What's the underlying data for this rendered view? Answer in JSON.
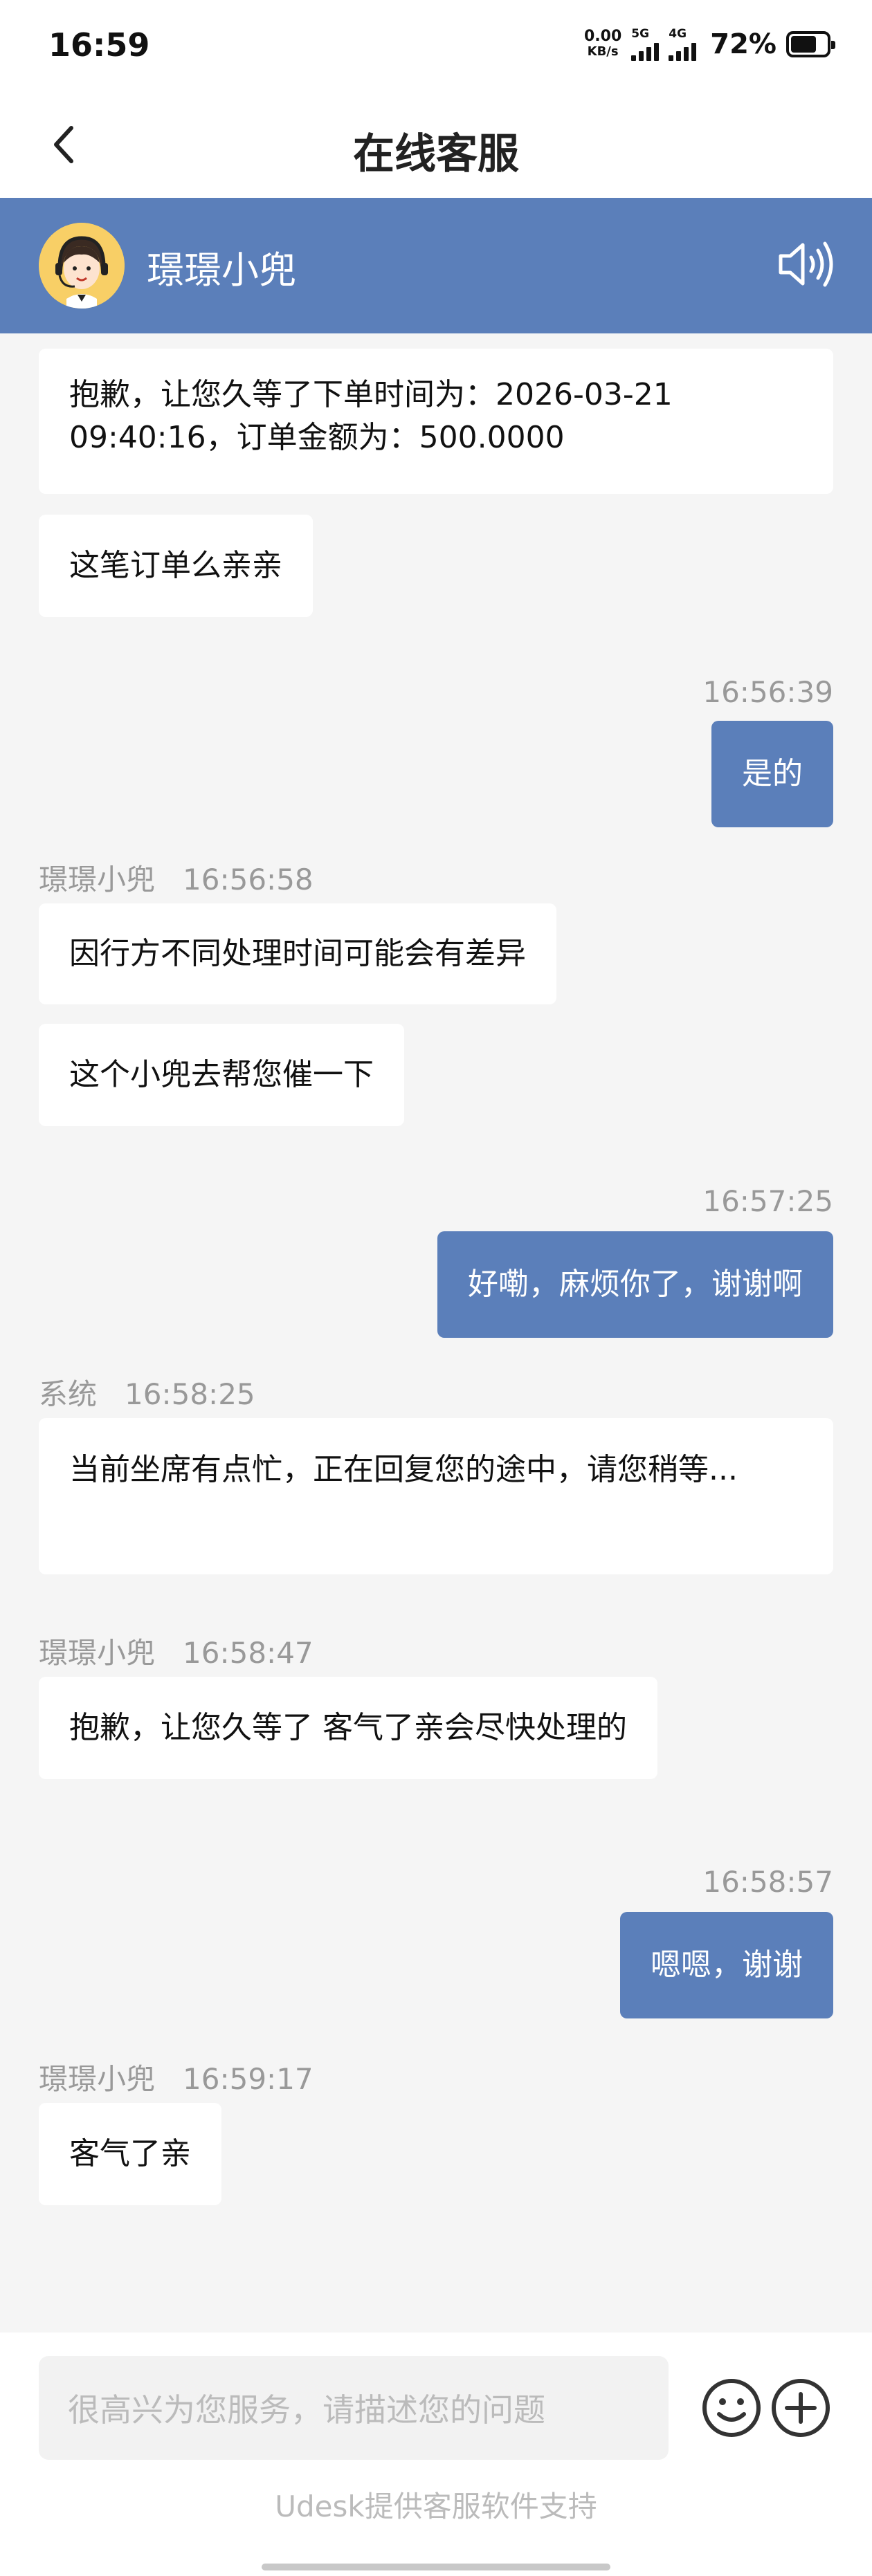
{
  "status_bar": {
    "time": "16:59",
    "net_speed": "0.00",
    "net_unit": "KB/s",
    "sim1_type": "5G",
    "sim2_type": "4G",
    "battery": "72%",
    "battery_level": 0.72
  },
  "nav": {
    "back_icon": "chevron-left-icon",
    "title": "在线客服"
  },
  "agent": {
    "name": "璟璟小兜",
    "avatar_icon": "customer-service-avatar",
    "sound_icon": "speaker-icon"
  },
  "chat": {
    "m1": "抱歉，让您久等了下单时间为：2026-03-21 09:40:16，订单金额为：500.0000",
    "m2": "这笔订单么亲亲",
    "t3": "16:56:39",
    "m3": "是的",
    "s4": "璟璟小兜",
    "t4": "16:56:58",
    "m4": "因行方不同处理时间可能会有差异",
    "m5": "这个小兜去帮您催一下",
    "t6": "16:57:25",
    "m6": "好嘞，麻烦你了，谢谢啊",
    "s7": "系统",
    "t7": "16:58:25",
    "m7": "当前坐席有点忙，正在回复您的途中，请您稍等...",
    "s8": "璟璟小兜",
    "t8": "16:58:47",
    "m8": "抱歉，让您久等了 客气了亲会尽快处理的",
    "t9": "16:58:57",
    "m9": "嗯嗯，谢谢",
    "s10": "璟璟小兜",
    "t10": "16:59:17",
    "m10": "客气了亲"
  },
  "input": {
    "placeholder": "很高兴为您服务，请描述您的问题",
    "emoji_icon": "emoji-icon",
    "plus_icon": "plus-icon",
    "support_text": "Udesk提供客服软件支持"
  },
  "colors": {
    "brand": "#5b7fba",
    "background": "#f5f5f5",
    "bubble_in": "#ffffff"
  }
}
